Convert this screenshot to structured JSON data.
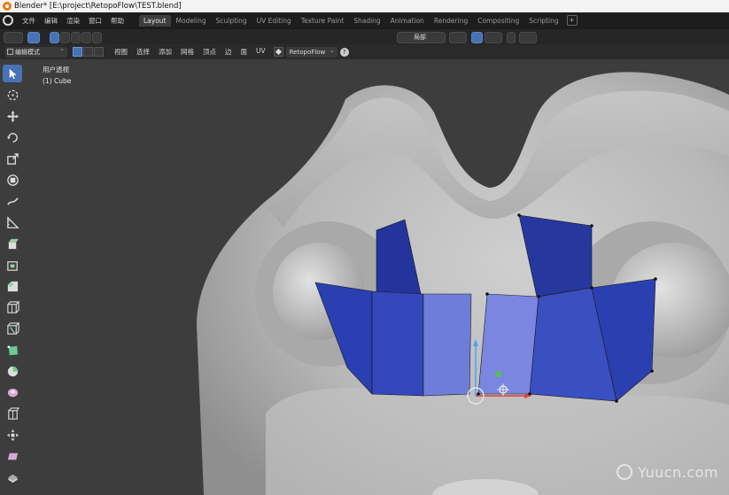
{
  "window": {
    "title": "Blender* [E:\\project\\RetopoFlow\\TEST.blend]"
  },
  "menu": {
    "items": [
      "文件",
      "编辑",
      "渲染",
      "窗口",
      "帮助"
    ]
  },
  "workspaces": {
    "tabs": [
      "Layout",
      "Modeling",
      "Sculpting",
      "UV Editing",
      "Texture Paint",
      "Shading",
      "Animation",
      "Rendering",
      "Compositing",
      "Scripting"
    ],
    "active": "Layout"
  },
  "header": {
    "pivot_label": "局部",
    "mode": "编辑模式",
    "menus": [
      "视图",
      "选择",
      "添加",
      "网格",
      "顶点",
      "边",
      "面",
      "UV"
    ],
    "addon": "RetopoFlow",
    "help": "?"
  },
  "viewport": {
    "perspective": "用户透视",
    "object": "(1) Cube"
  },
  "tools": [
    "select-box-icon",
    "cursor-icon",
    "move-icon",
    "rotate-icon",
    "scale-icon",
    "transform-icon",
    "annotate-icon",
    "measure-icon",
    "extrude-region-icon",
    "inset-faces-icon",
    "bevel-icon",
    "loop-cut-icon",
    "knife-icon",
    "poly-build-icon",
    "spin-icon",
    "smooth-icon",
    "edge-slide-icon",
    "shrink-fatten-icon",
    "shear-icon",
    "rip-region-icon"
  ],
  "watermark": "Yuucn.com",
  "colors": {
    "accent": "#4772b3",
    "face_dark": "#2a3fa8",
    "face_light": "#7a86e0"
  }
}
